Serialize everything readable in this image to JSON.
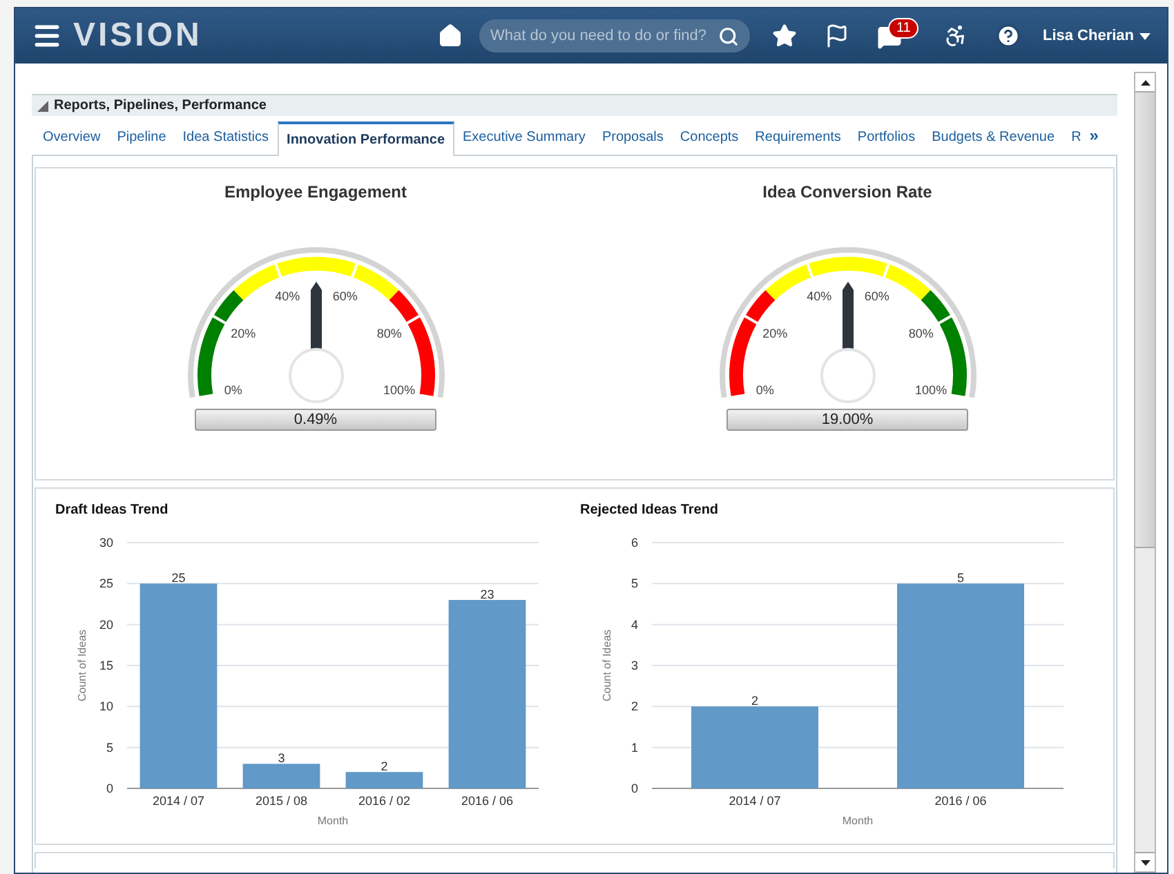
{
  "header": {
    "logo": "VISION",
    "search": {
      "placeholder": "What do you need to do or find?"
    },
    "notification_count": "11",
    "user": "Lisa Cherian"
  },
  "breadcrumb": "Reports, Pipelines, Performance",
  "tabs": [
    {
      "label": "Overview",
      "selected": false
    },
    {
      "label": "Pipeline",
      "selected": false
    },
    {
      "label": "Idea Statistics",
      "selected": false
    },
    {
      "label": "Innovation Performance",
      "selected": true
    },
    {
      "label": "Executive Summary",
      "selected": false
    },
    {
      "label": "Proposals",
      "selected": false
    },
    {
      "label": "Concepts",
      "selected": false
    },
    {
      "label": "Requirements",
      "selected": false
    },
    {
      "label": "Portfolios",
      "selected": false
    },
    {
      "label": "Budgets & Revenue",
      "selected": false
    },
    {
      "label": "R",
      "selected": false
    }
  ],
  "tabs_overflow": "»",
  "gauges": [
    {
      "title": "Employee Engagement",
      "bands": [
        {
          "color": "#008000"
        },
        {
          "color": "#ffff00"
        },
        {
          "color": "#ff0000"
        }
      ],
      "tick_labels": [
        "0%",
        "20%",
        "40%",
        "60%",
        "80%",
        "100%"
      ],
      "reading": "0.49%"
    },
    {
      "title": "Idea Conversion Rate",
      "bands": [
        {
          "color": "#ff0000"
        },
        {
          "color": "#ffff00"
        },
        {
          "color": "#008000"
        }
      ],
      "tick_labels": [
        "0%",
        "20%",
        "40%",
        "60%",
        "80%",
        "100%"
      ],
      "reading": "19.00%"
    }
  ],
  "charts": [
    {
      "chart_data": {
        "type": "bar",
        "title": "Draft Ideas Trend",
        "xlabel": "Month",
        "ylabel": "Count of Ideas",
        "categories": [
          "2014 / 07",
          "2015 / 08",
          "2016 / 02",
          "2016 / 06"
        ],
        "series": [
          {
            "color": "#6199c8",
            "values": [
              25,
              3,
              2,
              23
            ]
          }
        ],
        "ylim": [
          0,
          30
        ],
        "yticks": [
          0,
          5,
          10,
          15,
          20,
          25,
          30
        ],
        "grid": true,
        "data_labels": true
      }
    },
    {
      "chart_data": {
        "type": "bar",
        "title": "Rejected Ideas Trend",
        "xlabel": "Month",
        "ylabel": "Count of Ideas",
        "categories": [
          "2014 / 07",
          "2016 / 06"
        ],
        "series": [
          {
            "color": "#6199c8",
            "values": [
              2,
              5
            ]
          }
        ],
        "ylim": [
          0,
          6
        ],
        "yticks": [
          0,
          1,
          2,
          3,
          4,
          5,
          6
        ],
        "grid": true,
        "data_labels": true
      }
    }
  ]
}
